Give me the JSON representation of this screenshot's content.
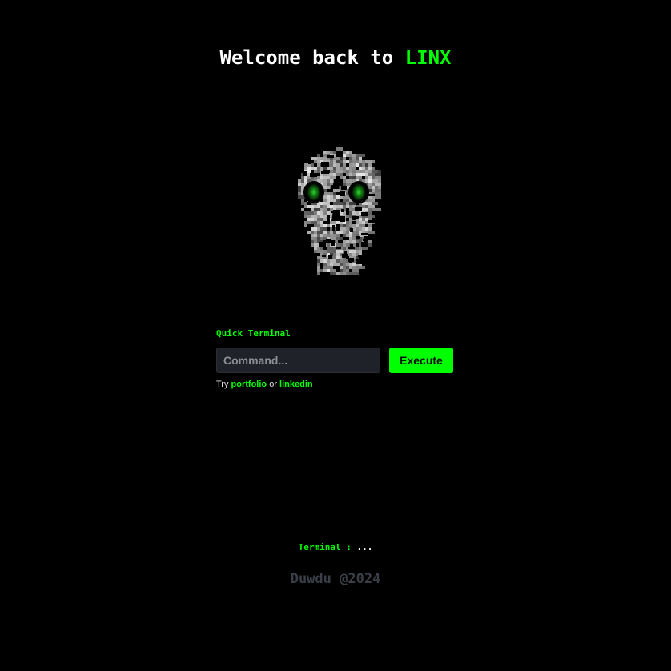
{
  "header": {
    "title_prefix": "Welcome back to ",
    "title_brand": "LINX"
  },
  "quick_terminal": {
    "label": "Quick Terminal",
    "input_placeholder": "Command...",
    "input_value": "",
    "execute_label": "Execute",
    "hint_prefix": "Try ",
    "hint_link1": "portfolio",
    "hint_middle": " or ",
    "hint_link2": "linkedin"
  },
  "status": {
    "label": "Terminal : ",
    "value": "..."
  },
  "footer": {
    "credit": "Duwdu @2024"
  },
  "colors": {
    "background": "#000000",
    "accent": "#00ff00",
    "input_bg": "#1f2329",
    "footer_text": "#3a3f47"
  },
  "icons": {
    "logo": "glitch-skull-icon"
  }
}
